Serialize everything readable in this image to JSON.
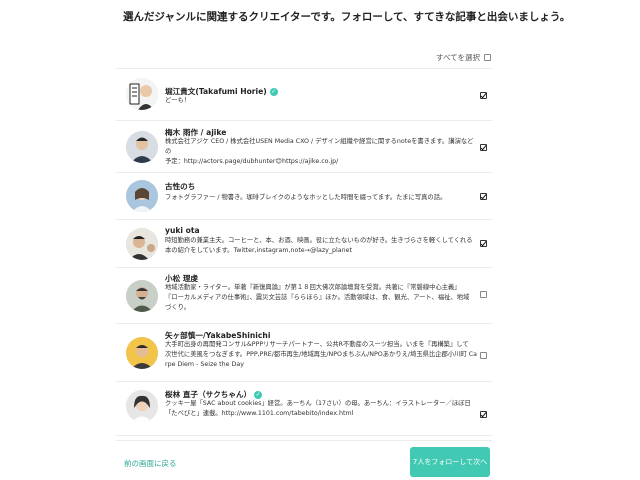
{
  "heading": "選んだジャンルに関連するクリエイターです。フォローして、すてきな記事と出会いましょう。",
  "select_all_label": "すべてを選択",
  "select_all_checked": false,
  "creators": [
    {
      "name": "堀江貴文(Takafumi Horie)",
      "verified": true,
      "bio": [
        "どーも！"
      ],
      "checked": true
    },
    {
      "name": "梅木 雨作 / ajike",
      "verified": false,
      "bio": [
        "株式会社アジケ CEO / 株式会社USEN Media CXO / デザイン組織や経営に関するnoteを書きます。講演などの",
        "予定：http://actors.page/dubhunter😊https://ajike.co.jp/"
      ],
      "checked": true
    },
    {
      "name": "古性のち",
      "verified": false,
      "bio": [
        "フォトグラファー / 物書き。珈琲ブレイクのようなホッとした時間を綴ってます。たまに写真の話。"
      ],
      "checked": true
    },
    {
      "name": "yuki ota",
      "verified": false,
      "bio": [
        "時短勤務の兼業主夫。コーヒーと、本、お酒、映画。役に立たないものが好き。生きづらさを軽くしてくれる",
        "本の紹介をしています。Twitter,instagram,note→@lazy_planet"
      ],
      "checked": true
    },
    {
      "name": "小松 理虔",
      "verified": false,
      "bio": [
        "地域活動家・ライター。単著『新復興論』が第１８回大佛次郎論壇賞を受賞。共著に『常磐線中心主義』",
        "『ローカルメディアの仕事術』、震災文芸誌『ららほら』ほか。活動領域は、食、観光、アート、福祉、地域",
        "づくり。"
      ],
      "checked": false
    },
    {
      "name": "矢ヶ部慎一/YakabeShinichi",
      "verified": false,
      "bio": [
        "大手町出身の再開発コンサル&PPPリサーチパートナー、公共R不動産のスーツ担当。いまを『再構築』して",
        "次世代に美風をつなぎます。PPP,PRE/都市再生/地域再生/NPOまちぶん/NPOあかりえ/埼玉県比企郡小川町 Ca",
        "rpe Diem - Seize the Day"
      ],
      "checked": false
    },
    {
      "name": "桜林 直子（サクちゃん）",
      "verified": true,
      "bio": [
        "クッキー屋「SAC about cookies」経営。あーちん（17さい）の母。あーちん：イラストレーター／ほぼ日",
        "「たべびと」連載。http://www.1101.com/tabebito/index.html"
      ],
      "checked": true
    }
  ],
  "back_link_label": "前の画面に戻る",
  "follow_button_label": "7人をフォローして次へ",
  "colors": {
    "accent": "#41c9b4",
    "link": "#2aa796"
  }
}
